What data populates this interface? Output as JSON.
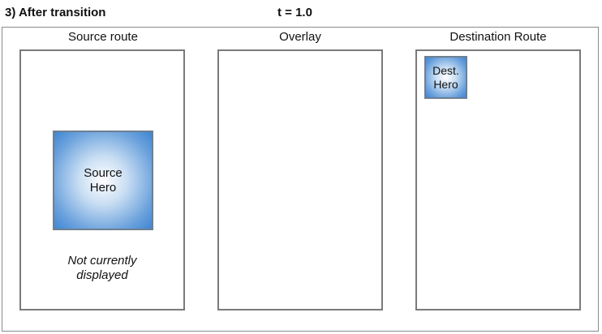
{
  "header": {
    "step_label": "3) After transition",
    "time_label": "t = 1.0"
  },
  "panels": [
    {
      "title": "Source route",
      "hero_label": "Source\nHero",
      "note": "Not currently\ndisplayed"
    },
    {
      "title": "Overlay"
    },
    {
      "title": "Destination Route",
      "hero_label": "Dest.\nHero"
    }
  ],
  "colors": {
    "hero_center": "#ffffff",
    "hero_edge": "#3e86d2",
    "panel_border": "#7a7a7a"
  }
}
